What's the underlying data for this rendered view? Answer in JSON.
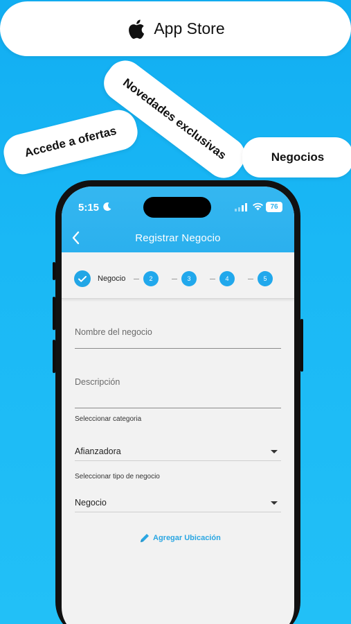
{
  "promo": {
    "store_label": "App Store",
    "tag_ofertas": "Accede a ofertas",
    "tag_novedades": "Novedades exclusivas",
    "tag_negocios": "Negocios"
  },
  "status_bar": {
    "time": "5:15",
    "battery": "76"
  },
  "nav": {
    "title": "Registrar Negocio"
  },
  "stepper": {
    "current_label": "Negocio",
    "steps": [
      "2",
      "3",
      "4",
      "5"
    ]
  },
  "form": {
    "name_placeholder": "Nombre del negocio",
    "description_placeholder": "Descripción",
    "category_label": "Seleccionar categoria",
    "category_value": "Afianzadora",
    "type_label": "Seleccionar tipo de negocio",
    "type_value": "Negocio",
    "add_location": "Agregar Ubicación"
  },
  "colors": {
    "accent": "#22a6e6",
    "background": "#1ab8f5"
  }
}
